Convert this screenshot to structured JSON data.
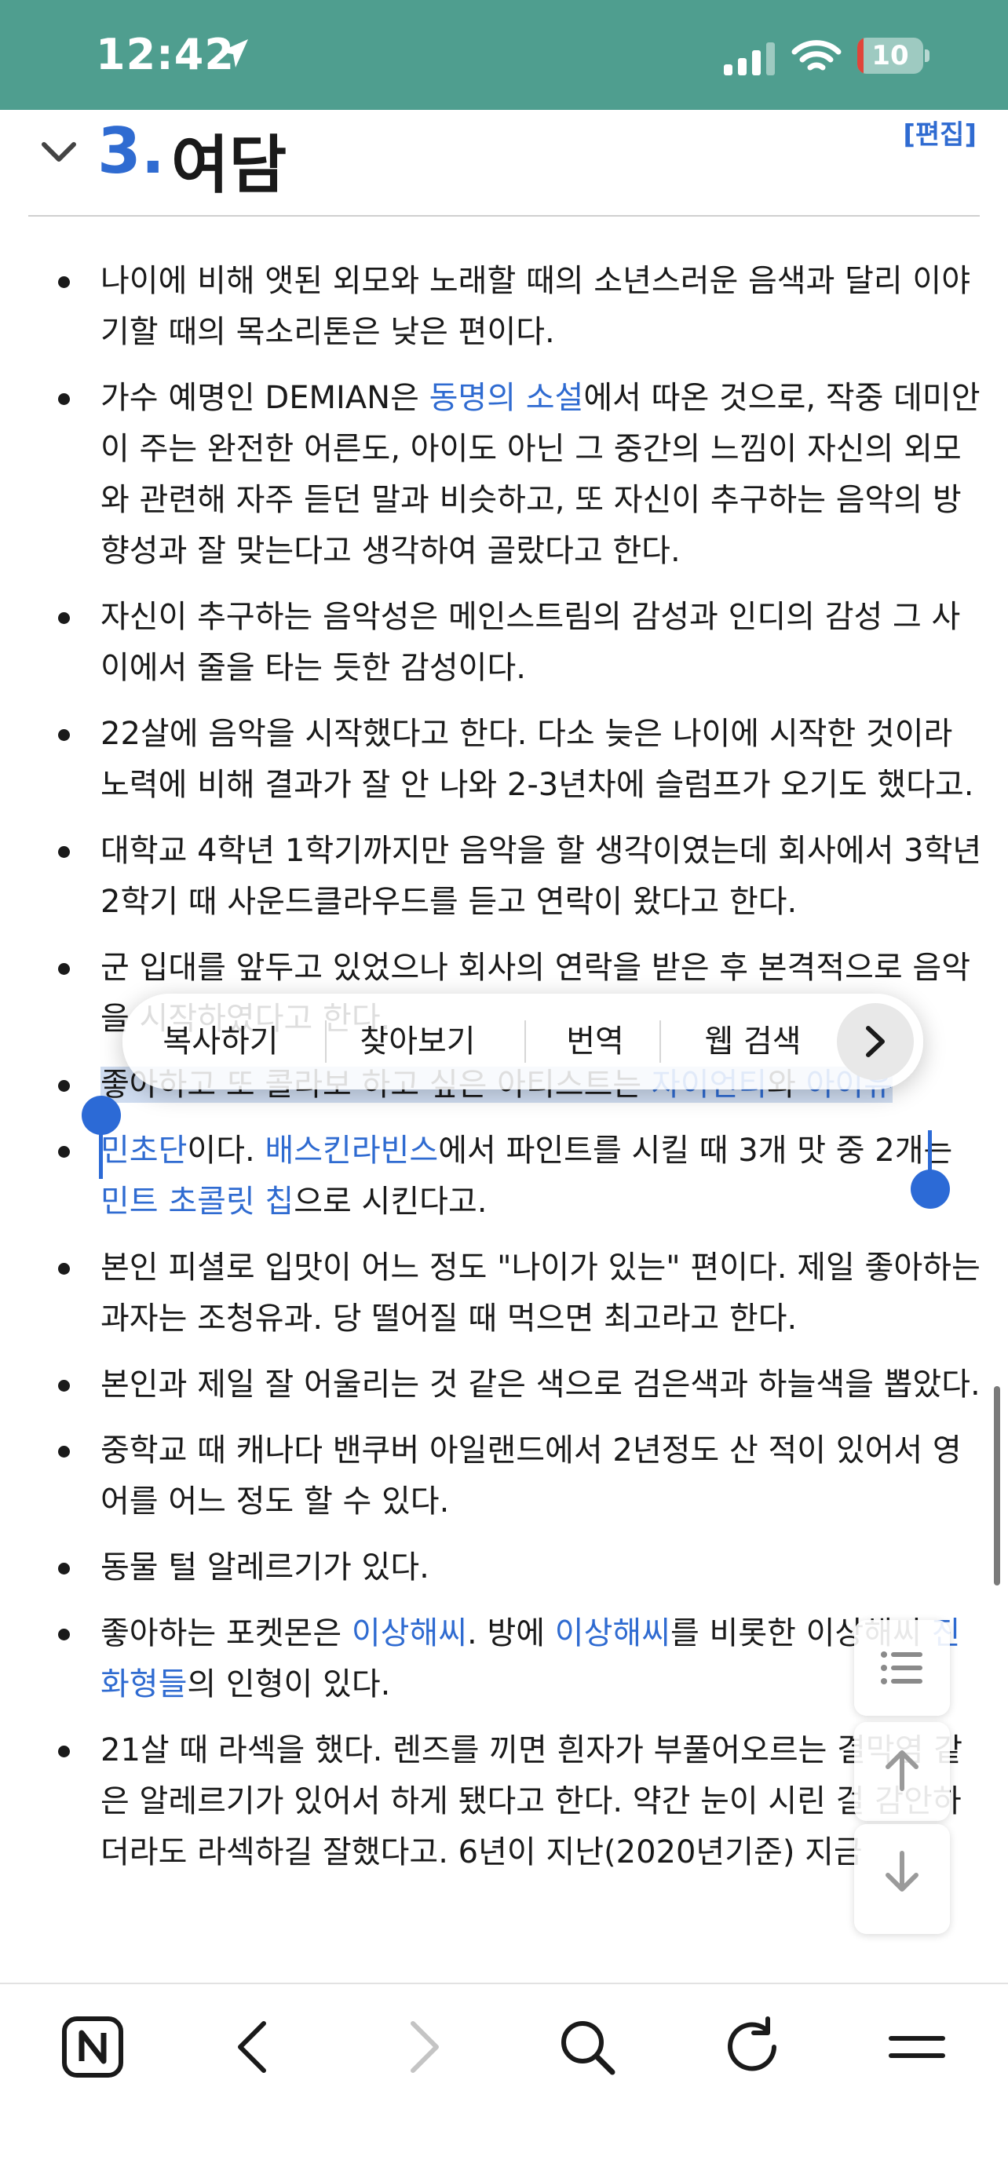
{
  "status_bar": {
    "time": "12:42",
    "battery": 10,
    "battery_label": "10",
    "bg_color": "#4f9e8f"
  },
  "section": {
    "number": "3.",
    "title": "여담",
    "edit_label": "[편집]"
  },
  "items": [
    {
      "segments": [
        {
          "t": "나이에 비해 앳된 외모와 노래할 때의 소년스러운 음색과 달리 이야기할 때의 목소리톤은 낮은 편이다."
        }
      ]
    },
    {
      "segments": [
        {
          "t": "가수 예명인 DEMIAN은 "
        },
        {
          "t": "동명의 소설",
          "link": true
        },
        {
          "t": "에서 따온 것으로, 작중 데미안이 주는 완전한 어른도, 아이도 아닌 그 중간의 느낌이 자신의 외모와 관련해 자주 듣던 말과 비슷하고, 또 자신이 추구하는 음악의 방향성과 잘 맞는다고 생각하여 골랐다고 한다."
        }
      ]
    },
    {
      "segments": [
        {
          "t": "자신이 추구하는 음악성은 메인스트림의 감성과 인디의 감성 그 사이에서 줄을 타는 듯한 감성이다."
        }
      ]
    },
    {
      "segments": [
        {
          "t": "22살에 음악을 시작했다고 한다. 다소 늦은 나이에 시작한 것이라 노력에 비해 결과가 잘 안 나와 2-3년차에 슬럼프가 오기도 했다고."
        }
      ]
    },
    {
      "segments": [
        {
          "t": "대학교 4학년 1학기까지만 음악을 할 생각이였는데 회사에서 3학년 2학기 때 사운드클라우드를 듣고 연락이 왔다고 한다."
        }
      ]
    },
    {
      "segments": [
        {
          "t": "군 입대를 앞두고 있었으나 회사의 연락을 받은 후 본격적으로 음악을 시작하였다고 한다."
        }
      ]
    },
    {
      "segments": [
        {
          "t": "좋아하고 또 콜라보 하고 싶은 아티스트는 ",
          "hl": true
        },
        {
          "t": "자이언티",
          "link": true,
          "hl": true
        },
        {
          "t": "와 ",
          "hl": true
        },
        {
          "t": "아이유",
          "link": true,
          "hl": true
        }
      ]
    },
    {
      "segments": [
        {
          "t": "민초단",
          "link": true
        },
        {
          "t": "이다. "
        },
        {
          "t": "배스킨라빈스",
          "link": true
        },
        {
          "t": "에서 파인트를 시킬 때 3개 맛 중 2개는 "
        },
        {
          "t": "민트 초콜릿 칩",
          "link": true
        },
        {
          "t": "으로 시킨다고."
        }
      ]
    },
    {
      "segments": [
        {
          "t": "본인 피셜로 입맛이 어느 정도 \"나이가 있는\" 편이다. 제일 좋아하는 과자는 조청유과. 당 떨어질 때 먹으면 최고라고 한다."
        }
      ]
    },
    {
      "segments": [
        {
          "t": "본인과 제일 잘 어울리는 것 같은 색으로 검은색과 하늘색을 뽑았다."
        }
      ]
    },
    {
      "segments": [
        {
          "t": "중학교 때 캐나다 밴쿠버 아일랜드에서 2년정도 산 적이 있어서 영어를 어느 정도 할 수 있다."
        }
      ]
    },
    {
      "segments": [
        {
          "t": "동물 털 알레르기가 있다."
        }
      ]
    },
    {
      "segments": [
        {
          "t": "좋아하는 포켓몬은 "
        },
        {
          "t": "이상해씨",
          "link": true
        },
        {
          "t": ". 방에 "
        },
        {
          "t": "이상해씨",
          "link": true
        },
        {
          "t": "를 비롯한 이상해씨 "
        },
        {
          "t": "진화형들",
          "link": true
        },
        {
          "t": "의 인형이 있다."
        }
      ]
    },
    {
      "segments": [
        {
          "t": "21살 때 라섹을 했다. 렌즈를 끼면 흰자가 부풀어오르는 결막염 같은 알레르기가 있어서 하게 됐다고 한다. 약간 눈이 시린 걸 감안하더라도 라섹하길 잘했다고. 6년이 지난(2020년기준) 지금"
        }
      ]
    }
  ],
  "context_menu": {
    "items": [
      "복사하기",
      "찾아보기",
      "번역",
      "웹 검색"
    ],
    "more_icon": "chevron-right-icon"
  },
  "toolbar": {
    "icons": [
      "namu-logo-icon",
      "back-icon",
      "forward-icon",
      "search-icon",
      "reload-icon",
      "menu-icon"
    ]
  },
  "colors": {
    "accent": "#2f6bd1",
    "selection": "#cfdcf0",
    "handle": "#2c6ad6",
    "battery_low": "#e0453a"
  }
}
